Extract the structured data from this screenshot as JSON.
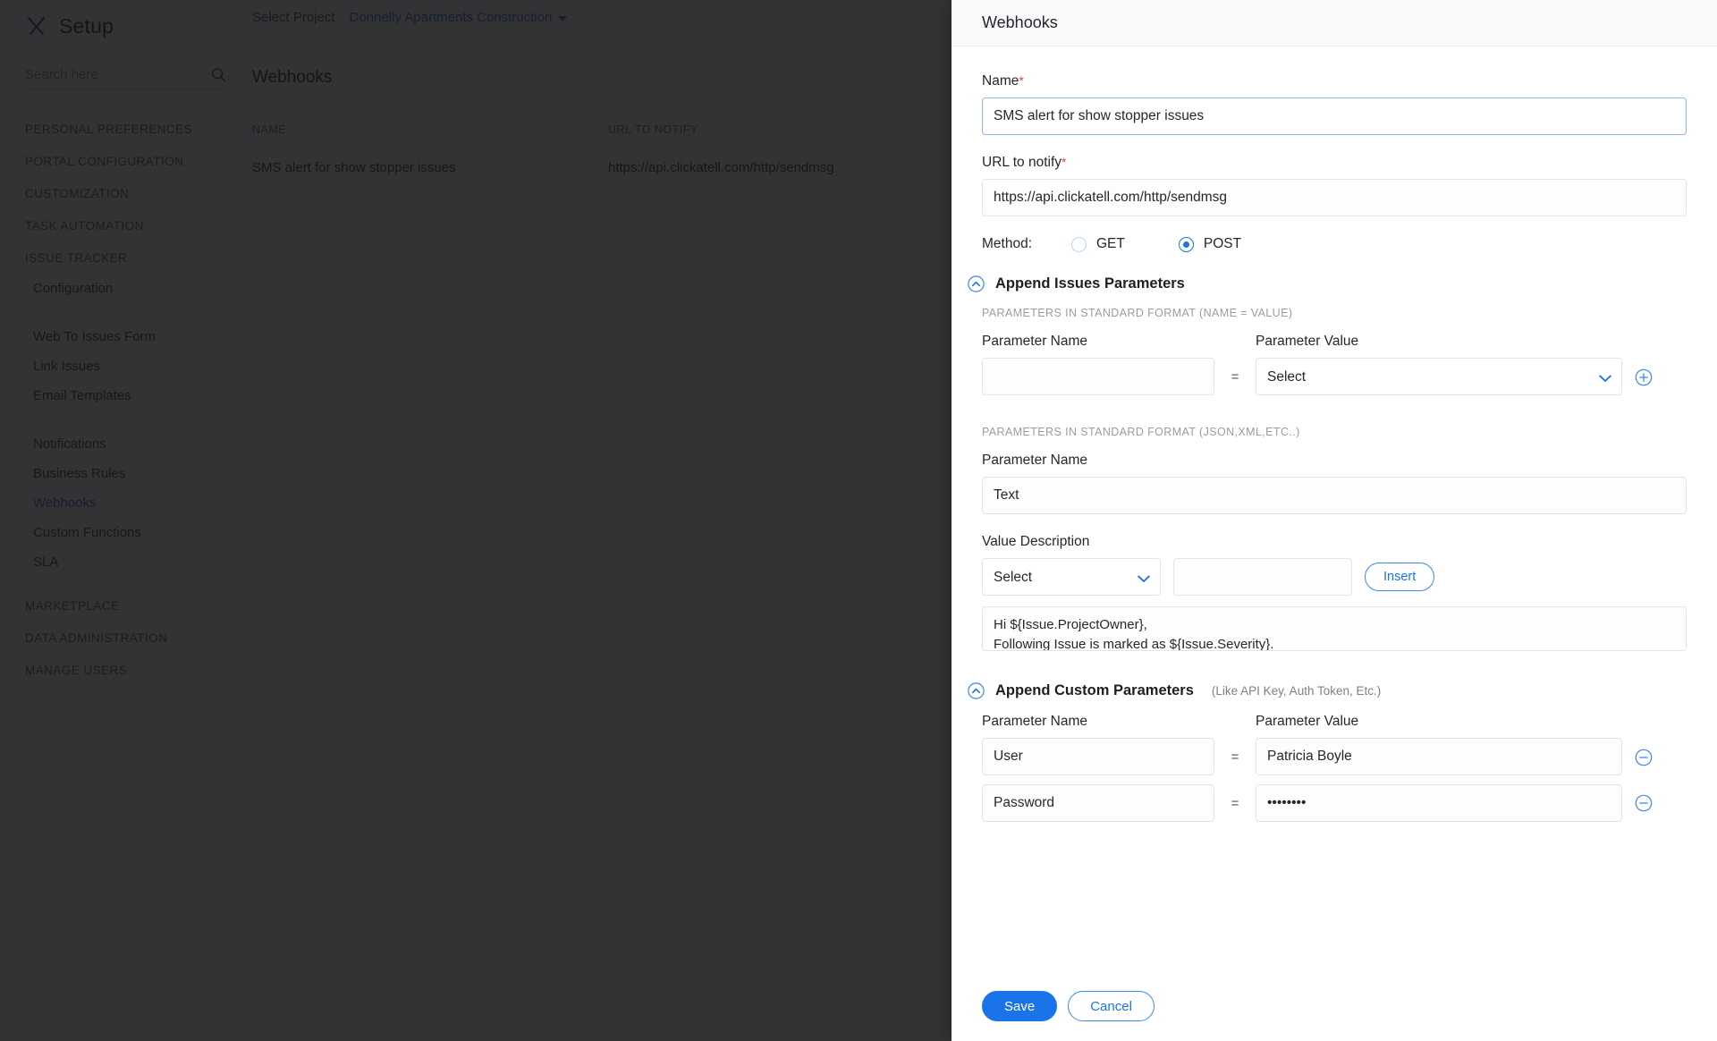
{
  "sidebar": {
    "brand": "Setup",
    "brand_icon": "tools-icon",
    "search_placeholder": "Search here",
    "search_value": "",
    "nav": [
      {
        "type": "section",
        "label": "PERSONAL PREFERENCES"
      },
      {
        "type": "section",
        "label": "PORTAL CONFIGURATION"
      },
      {
        "type": "section",
        "label": "CUSTOMIZATION"
      },
      {
        "type": "section",
        "label": "TASK AUTOMATION"
      },
      {
        "type": "section",
        "label": "ISSUE TRACKER"
      },
      {
        "type": "item",
        "label": "Configuration",
        "active": false
      },
      {
        "type": "rule"
      },
      {
        "type": "item",
        "label": "Web To Issues Form",
        "active": false
      },
      {
        "type": "item",
        "label": "Link Issues",
        "active": false
      },
      {
        "type": "item",
        "label": "Email Templates",
        "active": false
      },
      {
        "type": "rule"
      },
      {
        "type": "item",
        "label": "Notifications",
        "active": false
      },
      {
        "type": "item",
        "label": "Business Rules",
        "active": false
      },
      {
        "type": "item",
        "label": "Webhooks",
        "active": true
      },
      {
        "type": "item",
        "label": "Custom Functions",
        "active": false
      },
      {
        "type": "item",
        "label": "SLA",
        "active": false
      },
      {
        "type": "gap"
      },
      {
        "type": "section",
        "label": "MARKETPLACE"
      },
      {
        "type": "section",
        "label": "DATA ADMINISTRATION"
      },
      {
        "type": "section",
        "label": "MANAGE USERS"
      }
    ]
  },
  "topbar": {
    "select_project_label": "Select Project",
    "project_name": "Donnelly Apartments Construction"
  },
  "background_page": {
    "title": "Webhooks",
    "table": {
      "columns": [
        "NAME",
        "URL TO NOTIFY"
      ],
      "rows": [
        {
          "name": "SMS alert for show stopper issues",
          "url": "https://api.clickatell.com/http/sendmsg"
        }
      ]
    }
  },
  "panel": {
    "title": "Webhooks",
    "name_field": {
      "label": "Name",
      "required": true,
      "value": "SMS alert for show stopper issues",
      "placeholder": ""
    },
    "url_field": {
      "label": "URL to notify",
      "required": true,
      "value": "https://api.clickatell.com/http/sendmsg",
      "placeholder": ""
    },
    "method": {
      "label": "Method:",
      "options": [
        "GET",
        "POST"
      ],
      "selected": "POST"
    },
    "append_issues": {
      "title": "Append Issues Parameters",
      "expanded": true,
      "standard": {
        "caption": "PARAMETERS IN STANDARD FORMAT (NAME = VALUE)",
        "name_label": "Parameter Name",
        "value_label": "Parameter Value",
        "equals": "=",
        "rows": [
          {
            "name": "",
            "name_placeholder": "",
            "value": "Select",
            "add_icon": "plus-circle-icon"
          }
        ]
      },
      "structured": {
        "caption": "PARAMETERS IN STANDARD FORMAT (JSON,XML,ETC..)",
        "name_label": "Parameter Name",
        "name_value": "Text",
        "value_description_label": "Value Description",
        "value_description_select": "Select",
        "value_description_input": "",
        "insert_label": "Insert",
        "body_value": "Hi ${Issue.ProjectOwner},\nFollowing Issue is marked as ${Issue.Severity}.\nPlease assign a resource to resolve it."
      }
    },
    "append_custom": {
      "title": "Append Custom Parameters",
      "note": "(Like API Key, Auth Token, Etc.)",
      "expanded": true,
      "name_label": "Parameter Name",
      "value_label": "Parameter Value",
      "equals": "=",
      "rows": [
        {
          "name": "User",
          "value": "Patricia Boyle",
          "remove_icon": "minus-circle-icon"
        },
        {
          "name": "Password",
          "value": "••••••••",
          "remove_icon": "minus-circle-icon"
        }
      ]
    },
    "footer": {
      "save_label": "Save",
      "cancel_label": "Cancel"
    }
  },
  "colors": {
    "accent": "#1a73e8",
    "link": "#2f6fd0",
    "required": "#e8453c",
    "panel_header_bg": "#f8f9fa",
    "overlay": "rgba(18,18,20,0.86)"
  }
}
